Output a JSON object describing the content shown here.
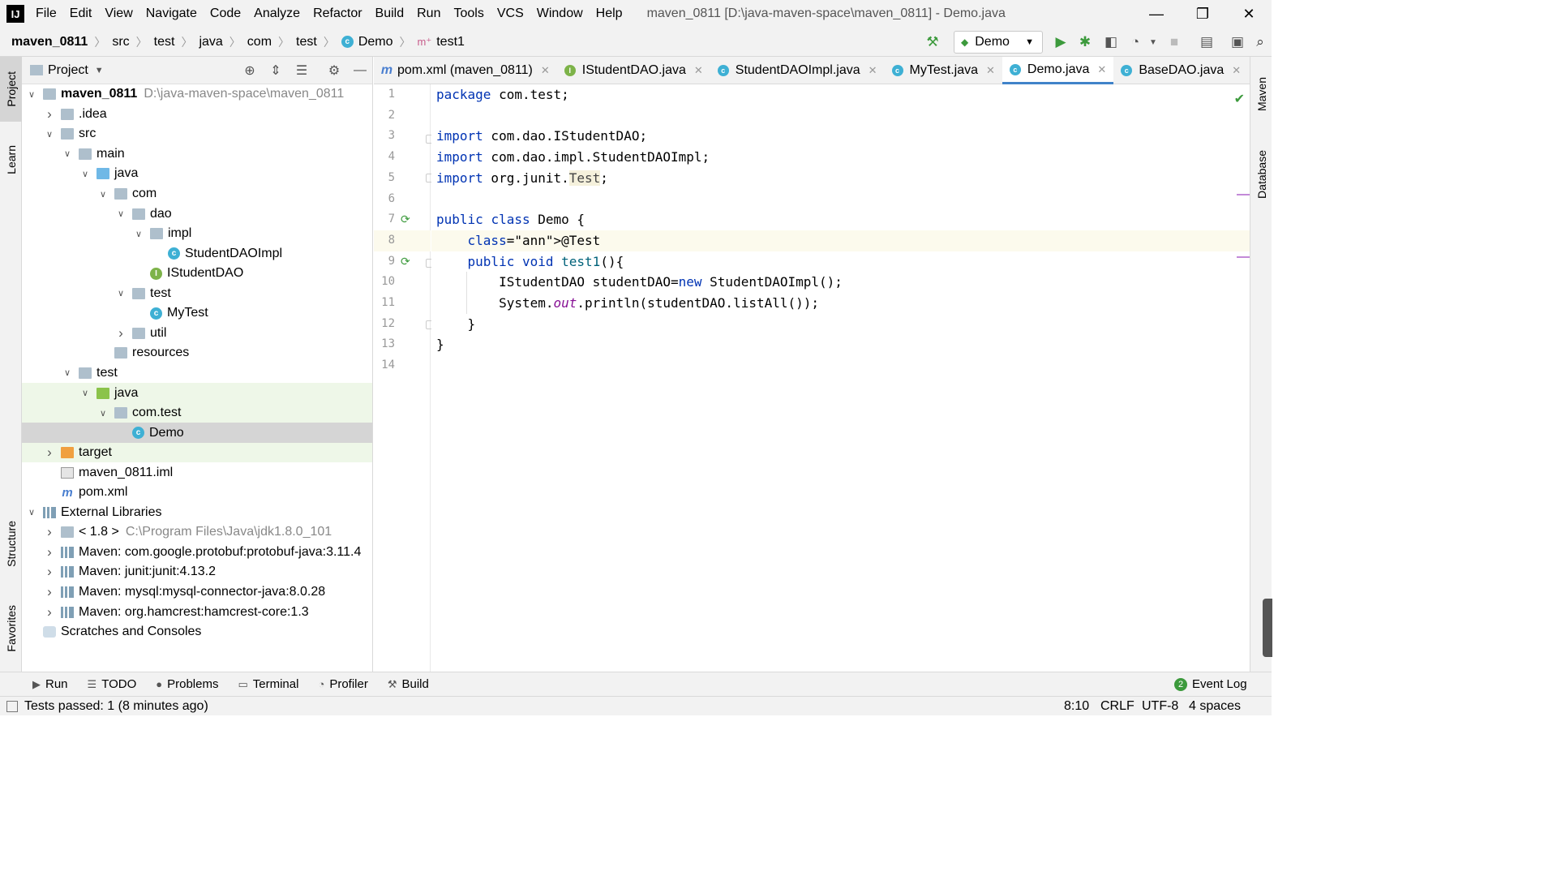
{
  "menu": [
    "File",
    "Edit",
    "View",
    "Navigate",
    "Code",
    "Analyze",
    "Refactor",
    "Build",
    "Run",
    "Tools",
    "VCS",
    "Window",
    "Help"
  ],
  "window_title": "maven_0811 [D:\\java-maven-space\\maven_0811] - Demo.java",
  "breadcrumbs": [
    "maven_0811",
    "src",
    "test",
    "java",
    "com",
    "test",
    "Demo",
    "test1"
  ],
  "run_config": "Demo",
  "project_panel": {
    "title": "Project"
  },
  "tree": [
    {
      "label": "maven_0811",
      "extra": "D:\\java-maven-space\\maven_0811",
      "bold": true,
      "depth": 0,
      "arrow": "open",
      "icon": "folder"
    },
    {
      "label": ".idea",
      "depth": 1,
      "arrow": "closed",
      "icon": "folder"
    },
    {
      "label": "src",
      "depth": 1,
      "arrow": "open",
      "icon": "folder"
    },
    {
      "label": "main",
      "depth": 2,
      "arrow": "open",
      "icon": "folder"
    },
    {
      "label": "java",
      "depth": 3,
      "arrow": "open",
      "icon": "folder-blue"
    },
    {
      "label": "com",
      "depth": 4,
      "arrow": "open",
      "icon": "folder"
    },
    {
      "label": "dao",
      "depth": 5,
      "arrow": "open",
      "icon": "folder"
    },
    {
      "label": "impl",
      "depth": 6,
      "arrow": "open",
      "icon": "folder"
    },
    {
      "label": "StudentDAOImpl",
      "depth": 7,
      "arrow": "none",
      "icon": "class"
    },
    {
      "label": "IStudentDAO",
      "depth": 6,
      "arrow": "none",
      "icon": "interface"
    },
    {
      "label": "test",
      "depth": 5,
      "arrow": "open",
      "icon": "folder"
    },
    {
      "label": "MyTest",
      "depth": 6,
      "arrow": "none",
      "icon": "class"
    },
    {
      "label": "util",
      "depth": 5,
      "arrow": "closed",
      "icon": "folder"
    },
    {
      "label": "resources",
      "depth": 4,
      "arrow": "none",
      "icon": "folder"
    },
    {
      "label": "test",
      "depth": 2,
      "arrow": "open",
      "icon": "folder"
    },
    {
      "label": "java",
      "depth": 3,
      "arrow": "open",
      "icon": "folder-green",
      "highlight": true
    },
    {
      "label": "com.test",
      "depth": 4,
      "arrow": "open",
      "icon": "folder",
      "highlight": true
    },
    {
      "label": "Demo",
      "depth": 5,
      "arrow": "none",
      "icon": "class",
      "selected": true
    },
    {
      "label": "target",
      "depth": 1,
      "arrow": "closed",
      "icon": "folder-orange",
      "highlight": true
    },
    {
      "label": "maven_0811.iml",
      "depth": 1,
      "arrow": "none",
      "icon": "file"
    },
    {
      "label": "pom.xml",
      "depth": 1,
      "arrow": "none",
      "icon": "maven"
    },
    {
      "label": "External Libraries",
      "depth": 0,
      "arrow": "open",
      "icon": "library"
    },
    {
      "label": "< 1.8 >",
      "extra": "C:\\Program Files\\Java\\jdk1.8.0_101",
      "depth": 1,
      "arrow": "closed",
      "icon": "jdk"
    },
    {
      "label": "Maven: com.google.protobuf:protobuf-java:3.11.4",
      "depth": 1,
      "arrow": "closed",
      "icon": "library"
    },
    {
      "label": "Maven: junit:junit:4.13.2",
      "depth": 1,
      "arrow": "closed",
      "icon": "library"
    },
    {
      "label": "Maven: mysql:mysql-connector-java:8.0.28",
      "depth": 1,
      "arrow": "closed",
      "icon": "library"
    },
    {
      "label": "Maven: org.hamcrest:hamcrest-core:1.3",
      "depth": 1,
      "arrow": "closed",
      "icon": "library"
    },
    {
      "label": "Scratches and Consoles",
      "depth": 0,
      "arrow": "none",
      "icon": "scratch"
    }
  ],
  "tabs": [
    {
      "label": "pom.xml (maven_0811)",
      "icon": "maven",
      "active": false
    },
    {
      "label": "IStudentDAO.java",
      "icon": "interface",
      "active": false
    },
    {
      "label": "StudentDAOImpl.java",
      "icon": "class",
      "active": false
    },
    {
      "label": "MyTest.java",
      "icon": "class",
      "active": false
    },
    {
      "label": "Demo.java",
      "icon": "class",
      "active": true
    },
    {
      "label": "BaseDAO.java",
      "icon": "class",
      "active": false
    }
  ],
  "code_lines": [
    "package com.test;",
    "",
    "import com.dao.IStudentDAO;",
    "import com.dao.impl.StudentDAOImpl;",
    "import org.junit.Test;",
    "",
    "public class Demo {",
    "    @Test",
    "    public void test1(){",
    "        IStudentDAO studentDAO=new StudentDAOImpl();",
    "        System.out.println(studentDAO.listAll());",
    "    }",
    "}",
    ""
  ],
  "side_tabs_left": [
    "Project",
    "Learn",
    "Structure",
    "Favorites"
  ],
  "side_tabs_right": [
    "Maven",
    "Database"
  ],
  "bottom_tools": [
    "Run",
    "TODO",
    "Problems",
    "Terminal",
    "Profiler",
    "Build"
  ],
  "event_log": "Event Log",
  "status": {
    "message": "Tests passed: 1 (8 minutes ago)",
    "position": "8:10",
    "line_sep": "CRLF",
    "encoding": "UTF-8",
    "indent": "4 spaces"
  },
  "colors": {
    "accent": "#4083c9",
    "keyword": "#0033b3",
    "annotation": "#9e880d"
  }
}
